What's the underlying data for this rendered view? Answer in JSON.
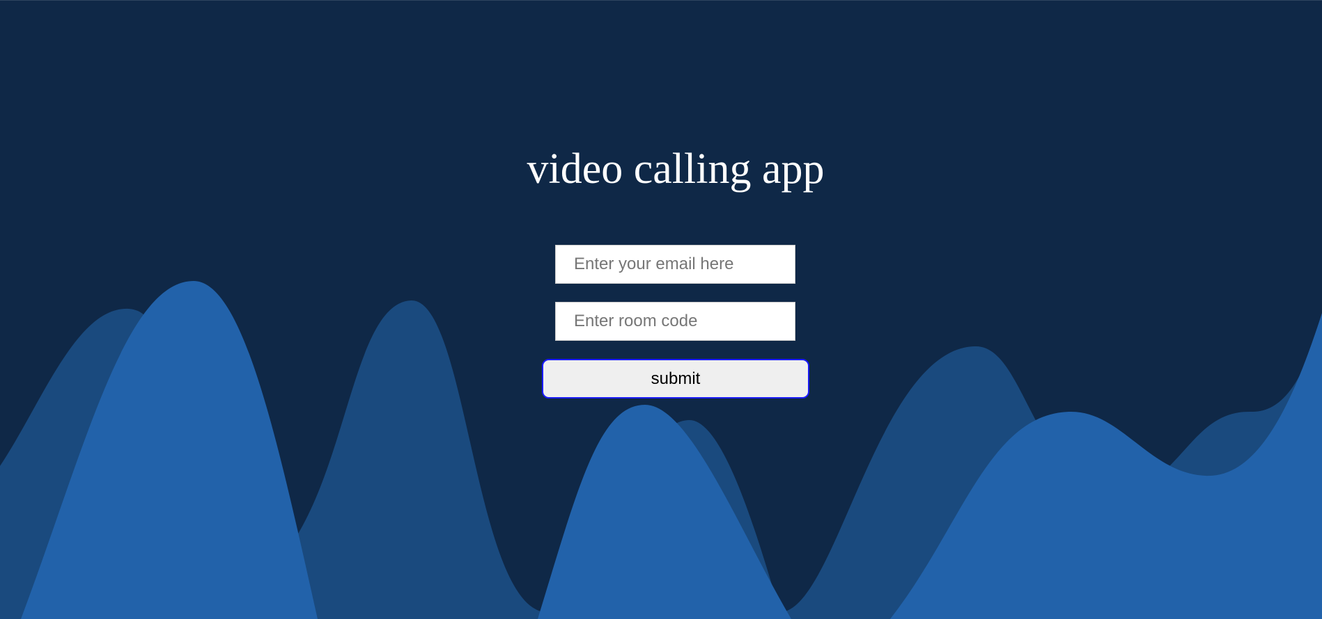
{
  "page": {
    "title": "video calling app"
  },
  "form": {
    "email_placeholder": "Enter your email here",
    "email_value": "",
    "room_placeholder": "Enter room code",
    "room_value": "",
    "submit_label": "submit"
  },
  "colors": {
    "background": "#0f2847",
    "wave_back": "#1a4a7e",
    "wave_front": "#2262aa",
    "button_border": "#1a1aff"
  }
}
